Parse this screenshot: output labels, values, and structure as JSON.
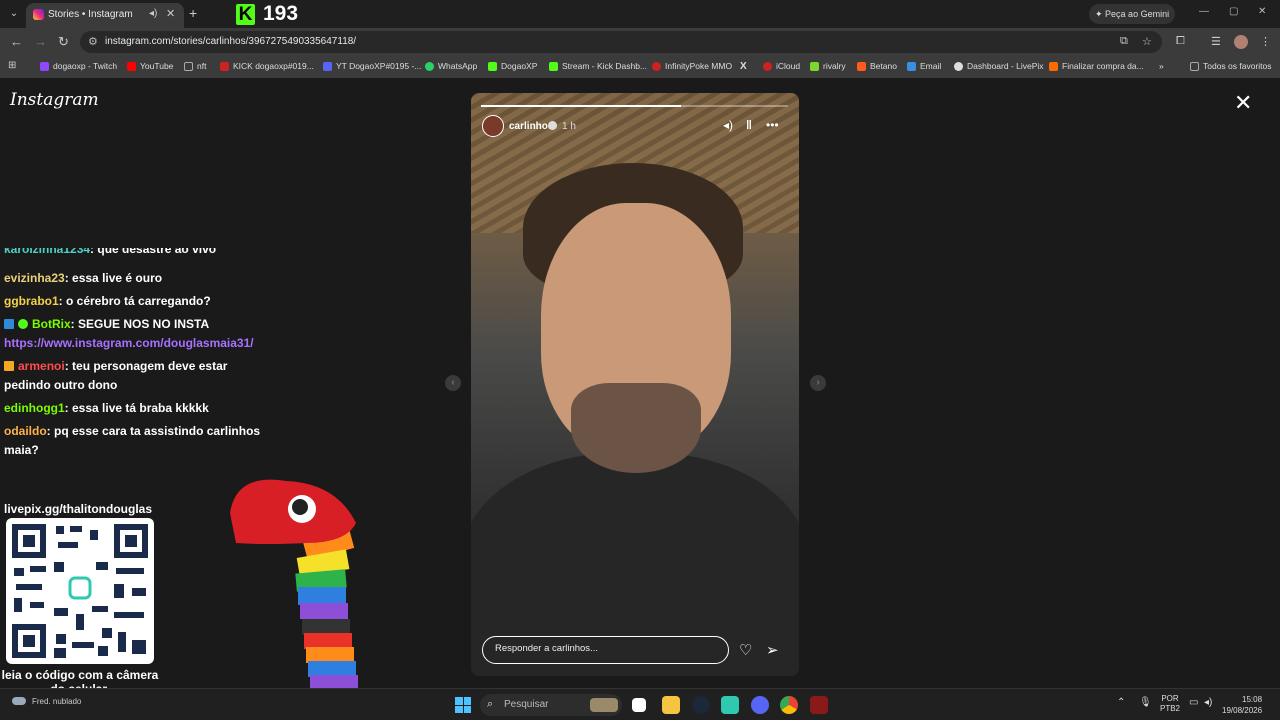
{
  "browser": {
    "tab_title": "Stories • Instagram",
    "kick_viewers": "193",
    "gemini_label": "Peça ao Gemini",
    "url": "instagram.com/stories/carlinhos/3967275490335647118/",
    "bookmarks": [
      {
        "label": "dogaoxp - Twitch",
        "color": "#9146ff"
      },
      {
        "label": "YouTube",
        "color": "#ff0000"
      },
      {
        "label": "nft",
        "color": "#888888"
      },
      {
        "label": "KICK dogaoxp#019...",
        "color": "#cc2222"
      },
      {
        "label": "YT DogaoXP#0195 -...",
        "color": "#5865f2"
      },
      {
        "label": "WhatsApp",
        "color": "#25d366"
      },
      {
        "label": "DogaoXP",
        "color": "#53fc18"
      },
      {
        "label": "Stream - Kick Dashb...",
        "color": "#53fc18"
      },
      {
        "label": "InfinityPoke MMO",
        "color": "#cc2222"
      },
      {
        "label": "X",
        "color": "#ffffff"
      },
      {
        "label": "iCloud",
        "color": "#cc2222"
      },
      {
        "label": "rivalry",
        "color": "#7cd82c"
      },
      {
        "label": "Betano",
        "color": "#ff5a1f"
      },
      {
        "label": "Email",
        "color": "#3b8de0"
      },
      {
        "label": "Dashboard - LivePix",
        "color": "#dddddd"
      },
      {
        "label": "Finalizar compra da...",
        "color": "#ff6a00"
      }
    ],
    "all_bookmarks_label": "Todos os favoritos"
  },
  "instagram": {
    "logo": "Instagram",
    "story": {
      "username": "carlinhos",
      "time_ago": "1 h",
      "progress": 0.65,
      "reply_placeholder": "Responder a carlinhos..."
    }
  },
  "chat": [
    {
      "user": "karolzinha1234",
      "user_color": "#4fd1c5",
      "message": ": que desastre ao vivo"
    },
    {
      "user": "evizinha23",
      "user_color": "#e8d27c",
      "message": ": essa live é ouro"
    },
    {
      "user": "ggbrabo1",
      "user_color": "#f2d14b",
      "message": ": o cérebro tá carregando?"
    },
    {
      "user": "BotRix",
      "user_color": "#7cfc00",
      "message": ": SEGUE NOS NO INSTA"
    },
    {
      "user": "",
      "user_color": "#a970ff",
      "message": "https://www.instagram.com/douglasmaia31/"
    },
    {
      "user": "armenoi",
      "user_color": "#ff4d4d",
      "message": ": teu personagem deve estar pedindo outro dono"
    },
    {
      "user": "edinhogg1",
      "user_color": "#7cfc00",
      "message": ": essa live tá braba kkkkk"
    },
    {
      "user": "odaildo",
      "user_color": "#ffb347",
      "message": ": pq esse cara ta assistindo carlinhos maia?"
    }
  ],
  "qr": {
    "top": "livepix.gg/thalitondouglas",
    "bottom": "leia o código com a câmera do celular."
  },
  "taskbar": {
    "weather": "Fred. nublado",
    "search_placeholder": "Pesquisar",
    "lang": "POR",
    "layout": "PTB2",
    "time": "15:08",
    "date": "19/08/2026"
  }
}
